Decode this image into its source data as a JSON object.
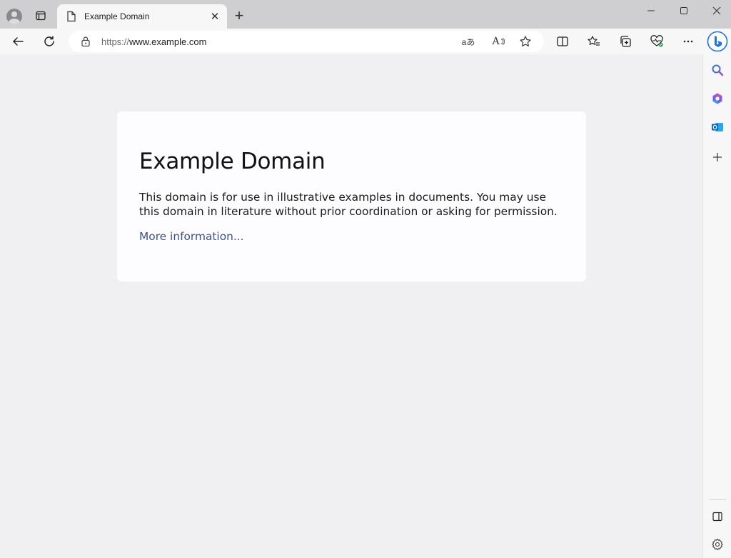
{
  "tab": {
    "title": "Example Domain",
    "close_label": "✕",
    "new_tab_label": "+"
  },
  "address_bar": {
    "scheme": "https://",
    "host": "www.example.com",
    "translate_label": "aあ",
    "read_aloud_label": "A"
  },
  "page": {
    "heading": "Example Domain",
    "body": "This domain is for use in illustrative examples in documents. You may use this domain in literature without prior coordination or asking for permission.",
    "link": "More information..."
  },
  "colors": {
    "link": "#3c4f8a",
    "page_bg": "#f0f0f2",
    "card_bg": "#fdfdff",
    "chrome": "#cfcfd1",
    "bing_accent": "#1a73e8"
  },
  "icons": {
    "profile": "avatar-icon",
    "workspaces": "tab-actions-icon",
    "favicon": "page-icon",
    "back": "back-arrow-icon",
    "refresh": "refresh-icon",
    "lock": "site-info-icon",
    "favorite": "star-icon",
    "split": "split-screen-icon",
    "favorites": "favorites-icon",
    "collections": "collections-icon",
    "health": "browser-essentials-icon",
    "more": "more-icon",
    "copilot": "bing-copilot-icon",
    "search": "search-icon",
    "office": "microsoft365-icon",
    "outlook": "outlook-icon",
    "add": "add-icon",
    "hide_sidebar": "hide-sidebar-icon",
    "settings": "settings-icon"
  }
}
